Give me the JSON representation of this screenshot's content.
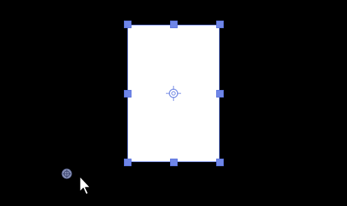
{
  "canvas": {
    "background_color": "#000000"
  },
  "shape": {
    "fill_color": "#ffffff",
    "selection_color": "#6f86e8"
  },
  "icons": {
    "rotation_center": "crosshair-target-icon",
    "pivot_marker": "gear-crosshair-icon",
    "cursor": "arrow-pointer-icon"
  }
}
